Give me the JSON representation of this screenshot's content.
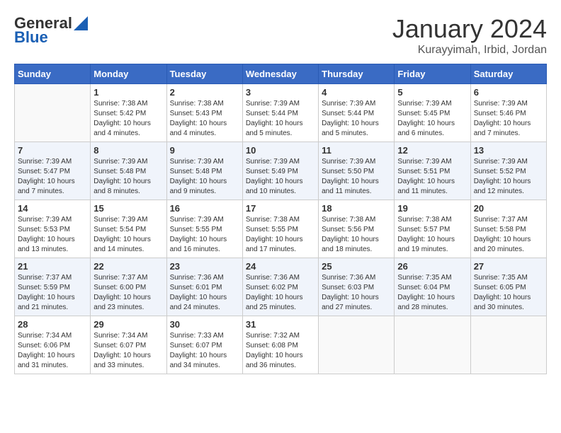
{
  "header": {
    "logo_general": "General",
    "logo_blue": "Blue",
    "title": "January 2024",
    "location": "Kurayyimah, Irbid, Jordan"
  },
  "weekdays": [
    "Sunday",
    "Monday",
    "Tuesday",
    "Wednesday",
    "Thursday",
    "Friday",
    "Saturday"
  ],
  "weeks": [
    [
      {
        "date": "",
        "info": ""
      },
      {
        "date": "1",
        "info": "Sunrise: 7:38 AM\nSunset: 5:42 PM\nDaylight: 10 hours\nand 4 minutes."
      },
      {
        "date": "2",
        "info": "Sunrise: 7:38 AM\nSunset: 5:43 PM\nDaylight: 10 hours\nand 4 minutes."
      },
      {
        "date": "3",
        "info": "Sunrise: 7:39 AM\nSunset: 5:44 PM\nDaylight: 10 hours\nand 5 minutes."
      },
      {
        "date": "4",
        "info": "Sunrise: 7:39 AM\nSunset: 5:44 PM\nDaylight: 10 hours\nand 5 minutes."
      },
      {
        "date": "5",
        "info": "Sunrise: 7:39 AM\nSunset: 5:45 PM\nDaylight: 10 hours\nand 6 minutes."
      },
      {
        "date": "6",
        "info": "Sunrise: 7:39 AM\nSunset: 5:46 PM\nDaylight: 10 hours\nand 7 minutes."
      }
    ],
    [
      {
        "date": "7",
        "info": "Sunrise: 7:39 AM\nSunset: 5:47 PM\nDaylight: 10 hours\nand 7 minutes."
      },
      {
        "date": "8",
        "info": "Sunrise: 7:39 AM\nSunset: 5:48 PM\nDaylight: 10 hours\nand 8 minutes."
      },
      {
        "date": "9",
        "info": "Sunrise: 7:39 AM\nSunset: 5:48 PM\nDaylight: 10 hours\nand 9 minutes."
      },
      {
        "date": "10",
        "info": "Sunrise: 7:39 AM\nSunset: 5:49 PM\nDaylight: 10 hours\nand 10 minutes."
      },
      {
        "date": "11",
        "info": "Sunrise: 7:39 AM\nSunset: 5:50 PM\nDaylight: 10 hours\nand 11 minutes."
      },
      {
        "date": "12",
        "info": "Sunrise: 7:39 AM\nSunset: 5:51 PM\nDaylight: 10 hours\nand 11 minutes."
      },
      {
        "date": "13",
        "info": "Sunrise: 7:39 AM\nSunset: 5:52 PM\nDaylight: 10 hours\nand 12 minutes."
      }
    ],
    [
      {
        "date": "14",
        "info": "Sunrise: 7:39 AM\nSunset: 5:53 PM\nDaylight: 10 hours\nand 13 minutes."
      },
      {
        "date": "15",
        "info": "Sunrise: 7:39 AM\nSunset: 5:54 PM\nDaylight: 10 hours\nand 14 minutes."
      },
      {
        "date": "16",
        "info": "Sunrise: 7:39 AM\nSunset: 5:55 PM\nDaylight: 10 hours\nand 16 minutes."
      },
      {
        "date": "17",
        "info": "Sunrise: 7:38 AM\nSunset: 5:55 PM\nDaylight: 10 hours\nand 17 minutes."
      },
      {
        "date": "18",
        "info": "Sunrise: 7:38 AM\nSunset: 5:56 PM\nDaylight: 10 hours\nand 18 minutes."
      },
      {
        "date": "19",
        "info": "Sunrise: 7:38 AM\nSunset: 5:57 PM\nDaylight: 10 hours\nand 19 minutes."
      },
      {
        "date": "20",
        "info": "Sunrise: 7:37 AM\nSunset: 5:58 PM\nDaylight: 10 hours\nand 20 minutes."
      }
    ],
    [
      {
        "date": "21",
        "info": "Sunrise: 7:37 AM\nSunset: 5:59 PM\nDaylight: 10 hours\nand 21 minutes."
      },
      {
        "date": "22",
        "info": "Sunrise: 7:37 AM\nSunset: 6:00 PM\nDaylight: 10 hours\nand 23 minutes."
      },
      {
        "date": "23",
        "info": "Sunrise: 7:36 AM\nSunset: 6:01 PM\nDaylight: 10 hours\nand 24 minutes."
      },
      {
        "date": "24",
        "info": "Sunrise: 7:36 AM\nSunset: 6:02 PM\nDaylight: 10 hours\nand 25 minutes."
      },
      {
        "date": "25",
        "info": "Sunrise: 7:36 AM\nSunset: 6:03 PM\nDaylight: 10 hours\nand 27 minutes."
      },
      {
        "date": "26",
        "info": "Sunrise: 7:35 AM\nSunset: 6:04 PM\nDaylight: 10 hours\nand 28 minutes."
      },
      {
        "date": "27",
        "info": "Sunrise: 7:35 AM\nSunset: 6:05 PM\nDaylight: 10 hours\nand 30 minutes."
      }
    ],
    [
      {
        "date": "28",
        "info": "Sunrise: 7:34 AM\nSunset: 6:06 PM\nDaylight: 10 hours\nand 31 minutes."
      },
      {
        "date": "29",
        "info": "Sunrise: 7:34 AM\nSunset: 6:07 PM\nDaylight: 10 hours\nand 33 minutes."
      },
      {
        "date": "30",
        "info": "Sunrise: 7:33 AM\nSunset: 6:07 PM\nDaylight: 10 hours\nand 34 minutes."
      },
      {
        "date": "31",
        "info": "Sunrise: 7:32 AM\nSunset: 6:08 PM\nDaylight: 10 hours\nand 36 minutes."
      },
      {
        "date": "",
        "info": ""
      },
      {
        "date": "",
        "info": ""
      },
      {
        "date": "",
        "info": ""
      }
    ]
  ]
}
